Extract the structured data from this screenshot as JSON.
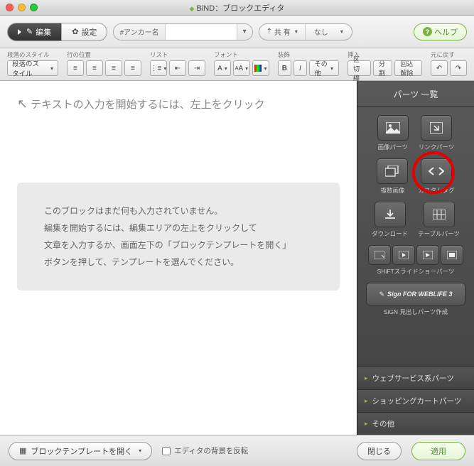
{
  "window": {
    "title": "BiND：ブロックエディタ"
  },
  "toolbar1": {
    "edit": "編集",
    "settings": "設定",
    "anchor_label": "#アンカー名",
    "share_label": "共 有",
    "share_value": "なし",
    "help": "ヘルプ"
  },
  "toolbar2": {
    "para_style": {
      "label": "段落のスタイル",
      "value": "段落のスタイル"
    },
    "line_pos": {
      "label": "行の位置"
    },
    "list": {
      "label": "リスト"
    },
    "font": {
      "label": "フォント"
    },
    "decoration": {
      "label": "装飾",
      "other": "その他"
    },
    "insert": {
      "label": "挿入",
      "divider": "区切線",
      "split": "分割",
      "wrap": "回込解除"
    },
    "undo": {
      "label": "元に戻す"
    }
  },
  "editor": {
    "hint": "テキストの入力を開始するには、左上をクリック",
    "msg1": "このブロックはまだ何も入力されていません。",
    "msg2": "編集を開始するには、編集エリアの左上をクリックして",
    "msg3": "文章を入力するか、画面左下の「ブロックテンプレートを開く」",
    "msg4": "ボタンを押して、テンプレートを選んでください。"
  },
  "side": {
    "title": "パーツ 一覧",
    "image": "画像パーツ",
    "link": "リンクパーツ",
    "multi": "複数画像",
    "custom": "カスタムタグ",
    "download": "ダウンロード",
    "table": "テーブルパーツ",
    "slideshow": "SHiFTスライドショーパーツ",
    "sign_text": "Sign FOR WEBLIFE 3",
    "sign_label": "SiGN 見出しパーツ作成",
    "acc1": "ウェブサービス系パーツ",
    "acc2": "ショッピングカートパーツ",
    "acc3": "その他"
  },
  "footer": {
    "template": "ブロックテンプレートを開く",
    "invert": "エディタの背景を反転",
    "close": "閉じる",
    "apply": "適用"
  }
}
